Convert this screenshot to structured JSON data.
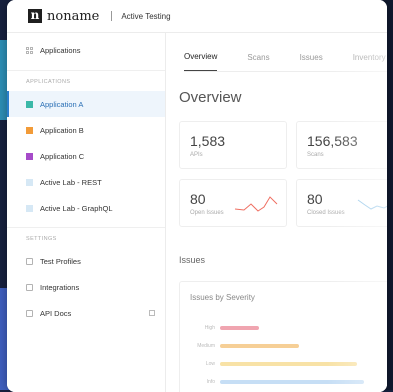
{
  "topbar": {
    "brand": "noname",
    "logo_letter": "n",
    "context": "Active Testing"
  },
  "sidebar": {
    "top_item": {
      "label": "Applications",
      "icon": "grid-icon"
    },
    "applications_section": "APPLICATIONS",
    "apps": [
      {
        "label": "Application A",
        "color": "#3bb8a8",
        "active": true
      },
      {
        "label": "Application B",
        "color": "#f29b38",
        "active": false
      },
      {
        "label": "Application C",
        "color": "#a64bc9",
        "active": false
      },
      {
        "label": "Active Lab - REST",
        "color": "#d6e8f5",
        "active": false
      },
      {
        "label": "Active Lab - GraphQL",
        "color": "#d6e8f5",
        "active": false
      }
    ],
    "settings_section": "SETTINGS",
    "settings": [
      {
        "label": "Test Profiles",
        "icon": "profiles-icon"
      },
      {
        "label": "Integrations",
        "icon": "integrations-icon"
      },
      {
        "label": "API Docs",
        "icon": "docs-icon",
        "external": true
      }
    ]
  },
  "tabs": [
    "Overview",
    "Scans",
    "Issues",
    "Inventory"
  ],
  "page_title": "Overview",
  "stats": [
    {
      "value": "1,583",
      "label": "APIs"
    },
    {
      "value": "156,583",
      "label": "Scans"
    },
    {
      "value": "80",
      "label": "Open Issues"
    },
    {
      "value": "80",
      "label": "Closed Issues"
    }
  ],
  "issues_heading": "Issues",
  "severity_card": {
    "title": "Issues by Severity",
    "rows": [
      {
        "label": "High",
        "value": 0.22,
        "color": "#f0a5b0"
      },
      {
        "label": "Medium",
        "value": 0.45,
        "color": "#f6cf96"
      },
      {
        "label": "Low",
        "value": 0.78,
        "color": "#f8e2a6"
      },
      {
        "label": "Info",
        "value": 0.82,
        "color": "#c6def5"
      }
    ]
  },
  "colors": {
    "accent": "#2a7ecb",
    "sparkline_open": "#ef6e61",
    "sparkline_closed": "#8fc4e8"
  }
}
